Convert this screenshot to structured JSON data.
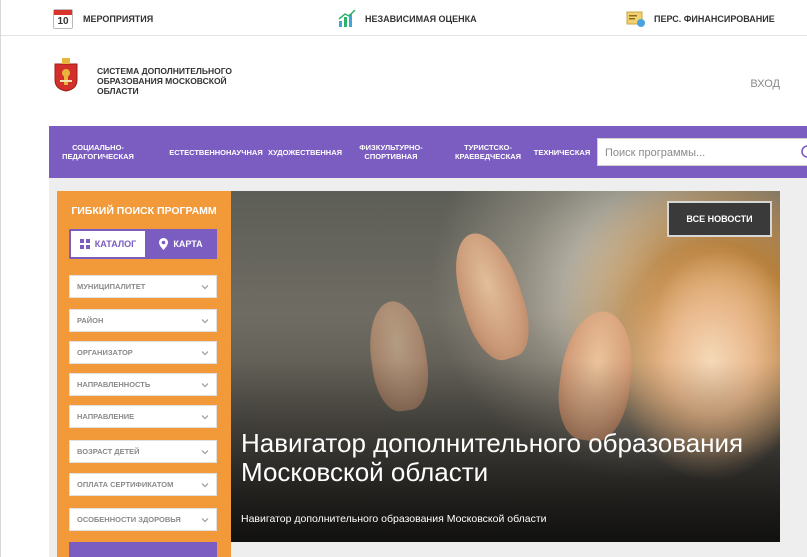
{
  "topbar": {
    "events": {
      "day": "10",
      "label": "МЕРОПРИЯТИЯ"
    },
    "rating": {
      "label": "НЕЗАВИСИМАЯ ОЦЕНКА"
    },
    "funding": {
      "label": "ПЕРС. ФИНАНСИРОВАНИЕ"
    }
  },
  "header": {
    "brand": "СИСТЕМА ДОПОЛНИТЕЛЬНОГО ОБРАЗОВАНИЯ МОСКОВСКОЙ ОБЛАСТИ",
    "brand_lines": [
      "СИСТЕМА ДОПОЛНИТЕЛЬНОГО",
      "ОБРАЗОВАНИЯ МОСКОВСКОЙ",
      "ОБЛАСТИ"
    ],
    "login": "ВХОД"
  },
  "nav": {
    "categories": [
      {
        "label": "СОЦИАЛЬНО-\nПЕДАГОГИЧЕСКАЯ"
      },
      {
        "label": "ЕСТЕСТВЕННОНАУЧНАЯ"
      },
      {
        "label": "ХУДОЖЕСТВЕННАЯ"
      },
      {
        "label": "ФИЗКУЛЬТУРНО-\nСПОРТИВНАЯ"
      },
      {
        "label": "ТУРИСТСКО-\nКРАЕВЕДЧЕСКАЯ"
      },
      {
        "label": "ТЕХНИЧЕСКАЯ"
      }
    ],
    "search_placeholder": "Поиск программы..."
  },
  "filters": {
    "title": "ГИБКИЙ ПОИСК ПРОГРАММ",
    "tabs": {
      "catalog": "КАТАЛОГ",
      "map": "КАРТА"
    },
    "selects": [
      "МУНИЦИПАЛИТЕТ",
      "РАЙОН",
      "ОРГАНИЗАТОР",
      "НАПРАВЛЕННОСТЬ",
      "НАПРАВЛЕНИЕ",
      "ВОЗРАСТ ДЕТЕЙ",
      "ОПЛАТА СЕРТИФИКАТОМ",
      "ОСОБЕННОСТИ ЗДОРОВЬЯ"
    ]
  },
  "hero": {
    "news_button": "ВСЕ НОВОСТИ",
    "title": "Навигатор дополнительного образования Московской области",
    "subtitle": "Навигатор дополнительного образования Московской области"
  },
  "colors": {
    "purple": "#7b5cc1",
    "orange": "#f29a3a",
    "calendar_red": "#d9342b"
  }
}
